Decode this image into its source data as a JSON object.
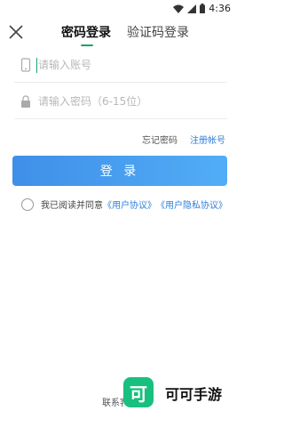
{
  "status_bar": {
    "time": "4:36"
  },
  "tabs": [
    {
      "label": "密码登录"
    },
    {
      "label": "验证码登录"
    }
  ],
  "form": {
    "account_placeholder": "请输入账号",
    "password_placeholder": "请输入密码（6-15位）"
  },
  "links": {
    "forgot": "忘记密码",
    "register": "注册帐号"
  },
  "login_button": "登 录",
  "agreement": {
    "prefix": "我已阅读并同意",
    "user_agreement": "《用户协议》",
    "privacy_agreement": "《用户隐私协议》"
  },
  "footer": {
    "contact": "联系客"
  },
  "watermark": {
    "logo_char": "可",
    "name": "可可手游"
  },
  "colors": {
    "accent": "#1ba36b",
    "button": "#4a9ff0",
    "link": "#2f7fd8",
    "logo": "#17c07f"
  }
}
